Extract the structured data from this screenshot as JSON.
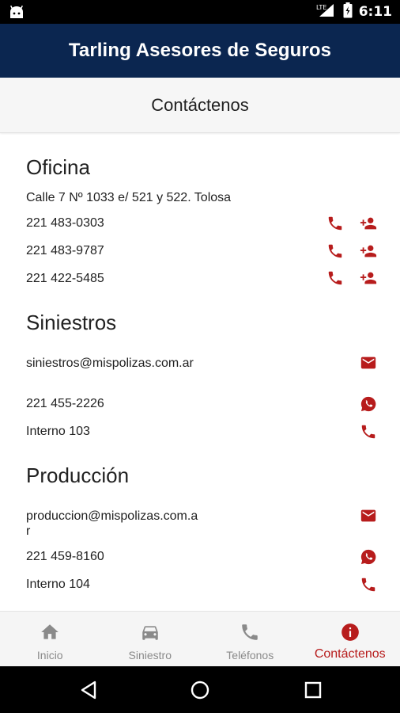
{
  "status_bar": {
    "network": "LTE",
    "time": "6:11"
  },
  "app_bar": {
    "title": "Tarling Asesores de Seguros"
  },
  "sub_header": {
    "title": "Contáctenos"
  },
  "sections": {
    "oficina": {
      "title": "Oficina",
      "address": "Calle 7 Nº 1033 e/ 521 y 522. Tolosa",
      "phones": [
        "221 483-0303",
        "221 483-9787",
        "221 422-5485"
      ]
    },
    "siniestros": {
      "title": "Siniestros",
      "email": "siniestros@mispolizas.com.ar",
      "whatsapp": "221 455-2226",
      "internal": "Interno 103"
    },
    "produccion": {
      "title": "Producción",
      "email": "produccion@mispolizas.com.ar",
      "whatsapp": "221 459-8160",
      "internal": "Interno 104"
    }
  },
  "icons": {
    "phone": "phone-icon",
    "add_contact": "add-contact-icon",
    "email": "email-icon",
    "whatsapp": "whatsapp-icon"
  },
  "bottom_nav": {
    "items": [
      {
        "label": "Inicio",
        "icon": "home-icon"
      },
      {
        "label": "Siniestro",
        "icon": "car-icon"
      },
      {
        "label": "Teléfonos",
        "icon": "phone-icon"
      },
      {
        "label": "Contáctenos",
        "icon": "info-icon",
        "active": true
      }
    ]
  },
  "colors": {
    "app_bar": "#0b2650",
    "accent": "#b71c1c",
    "nav_inactive": "#8a8a8a"
  }
}
